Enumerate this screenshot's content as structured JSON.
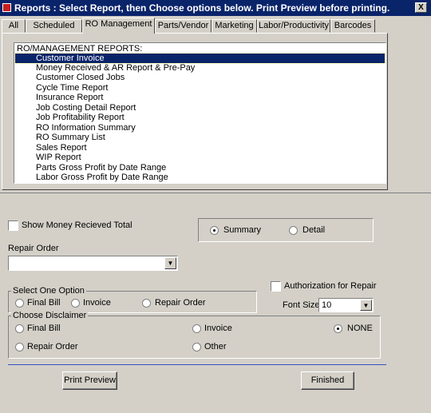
{
  "window": {
    "title": "Reports  : Select Report, then Choose options below. Print Preview before printing.",
    "close_glyph": "X"
  },
  "tabs": [
    {
      "label": "All"
    },
    {
      "label": "Scheduled"
    },
    {
      "label": "RO Management"
    },
    {
      "label": "Parts/Vendor"
    },
    {
      "label": "Marketing"
    },
    {
      "label": "Labor/Productivity"
    },
    {
      "label": "Barcodes"
    }
  ],
  "active_tab": "RO Management",
  "report_list": {
    "header": "RO/MANAGEMENT REPORTS:",
    "selected": "Customer Invoice",
    "items": [
      "Customer Invoice",
      "Money Received & AR Report & Pre-Pay",
      "Customer Closed Jobs",
      "Cycle Time Report",
      "Insurance Report",
      "Job Costing Detail Report",
      "Job Profitability Report",
      "RO Information Summary",
      "RO Summary List",
      "Sales Report",
      "WIP Report",
      "Parts Gross Profit by Date Range",
      "Labor Gross Profit by Date Range"
    ]
  },
  "options": {
    "show_money_label": "Show Money Recieved Total",
    "show_money_checked": false,
    "summary_label": "Summary",
    "detail_label": "Detail",
    "summary_selected": true,
    "repair_order_label": "Repair Order",
    "repair_order_value": "",
    "authorization_label": "Authorization for Repair",
    "authorization_checked": false,
    "font_size_label": "Font Size",
    "font_size_value": "10",
    "select_one_option": {
      "legend": "Select One Option",
      "final_bill": "Final Bill",
      "invoice": "Invoice",
      "repair_order": "Repair Order"
    },
    "disclaimer": {
      "legend": "Choose Disclaimer",
      "final_bill": "Final Bill",
      "invoice": "Invoice",
      "none": "NONE",
      "repair_order": "Repair Order",
      "other": "Other",
      "selected": "NONE"
    }
  },
  "buttons": {
    "print_preview": "Print Preview",
    "finished": "Finished"
  },
  "arrow_glyph": "▼"
}
